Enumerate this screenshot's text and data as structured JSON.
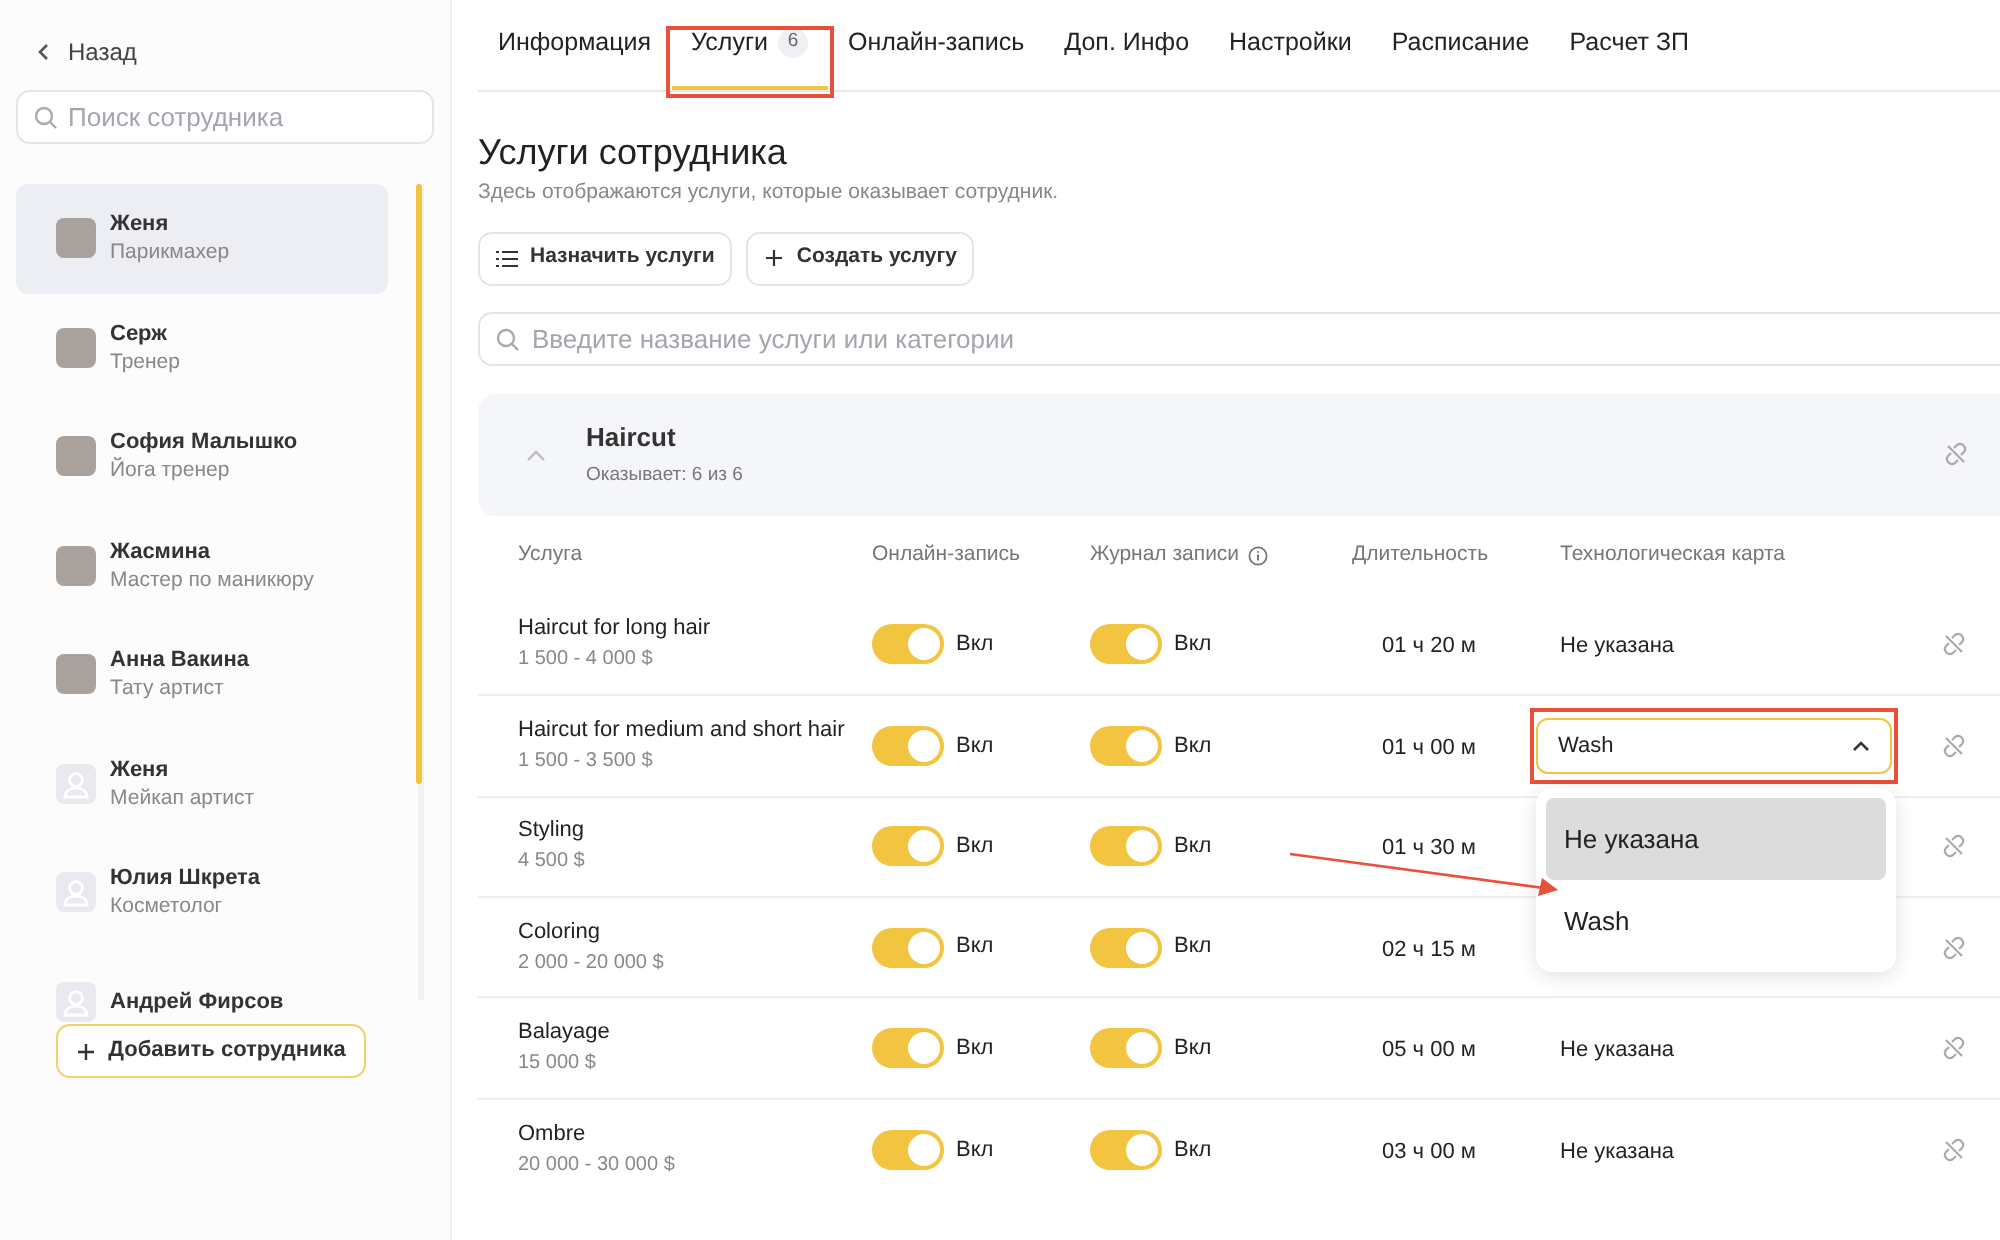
{
  "sidebar": {
    "back": "Назад",
    "search": {
      "placeholder": "Поиск сотрудника"
    },
    "employees": [
      {
        "name": "Женя",
        "role": "Парикмахер",
        "kind": "photo",
        "selected": true
      },
      {
        "name": "Серж",
        "role": "Тренер",
        "kind": "photo",
        "selected": false
      },
      {
        "name": "София Малышко",
        "role": "Йога тренер",
        "kind": "photo",
        "selected": false
      },
      {
        "name": "Жасмина",
        "role": "Мастер по маникюру",
        "kind": "photo",
        "selected": false
      },
      {
        "name": "Анна Вакина",
        "role": "Тату артист",
        "kind": "photo",
        "selected": false
      },
      {
        "name": "Женя",
        "role": "Мейкап артист",
        "kind": "placeholder",
        "selected": false
      },
      {
        "name": "Юлия Шкрета",
        "role": "Косметолог",
        "kind": "placeholder",
        "selected": false
      },
      {
        "name": "Андрей Фирсов",
        "kind": "placeholder",
        "selected": false
      }
    ],
    "add_button": "Добавить сотрудника"
  },
  "tabs": [
    {
      "label": "Информация",
      "selected": false,
      "highlighted": false
    },
    {
      "label": "Услуги",
      "count": "6",
      "selected": true,
      "highlighted": true
    },
    {
      "label": "Онлайн-запись",
      "selected": false,
      "highlighted": false
    },
    {
      "label": "Доп. Инфо",
      "selected": false,
      "highlighted": false
    },
    {
      "label": "Настройки",
      "selected": false,
      "highlighted": false
    },
    {
      "label": "Расписание",
      "selected": false,
      "highlighted": false
    },
    {
      "label": "Расчет ЗП",
      "selected": false,
      "highlighted": false
    }
  ],
  "title": "Услуги сотрудника",
  "subtitle": "Здесь отображаются услуги, которые оказывает сотрудник.",
  "buttons": [
    {
      "label": "Назначить услуги"
    },
    {
      "label": "Создать услугу"
    }
  ],
  "search": {
    "placeholder": "Введите название услуги или категории"
  },
  "category": {
    "name": "Haircut",
    "count": "Оказывает: 6 из 6",
    "expanded": true
  },
  "table": {
    "columns": [
      "Услуга",
      "Онлайн-запись",
      "Журнал записи",
      "Длительность",
      "Технологическая карта"
    ],
    "rows": [
      {
        "name": "Haircut for long hair",
        "price": "1 500 - 4 000 $",
        "online": {
          "on": true,
          "label": "Вкл"
        },
        "journal": {
          "on": true,
          "label": "Вкл"
        },
        "duration": "01 ч 20 м",
        "tech_card": {
          "kind": "text",
          "value": "Не указана"
        }
      },
      {
        "name": "Haircut for medium and short hair",
        "price": "1 500 - 3 500 $",
        "online": {
          "on": true,
          "label": "Вкл"
        },
        "journal": {
          "on": true,
          "label": "Вкл"
        },
        "duration": "01 ч 00 м",
        "tech_card": {
          "kind": "select",
          "value": "Wash",
          "expanded": true,
          "highlighted": true,
          "options": [
            {
              "label": "Не указана",
              "hovered": true
            },
            {
              "label": "Wash",
              "hovered": false
            }
          ]
        }
      },
      {
        "name": "Styling",
        "price": "4 500 $",
        "online": {
          "on": true,
          "label": "Вкл"
        },
        "journal": {
          "on": true,
          "label": "Вкл"
        },
        "duration": "01 ч 30 м",
        "tech_card": {
          "kind": "hidden"
        }
      },
      {
        "name": "Coloring",
        "price": "2 000 - 20 000 $",
        "online": {
          "on": true,
          "label": "Вкл"
        },
        "journal": {
          "on": true,
          "label": "Вкл"
        },
        "duration": "02 ч 15 м",
        "tech_card": {
          "kind": "hidden"
        }
      },
      {
        "name": "Balayage",
        "price": "15 000 $",
        "online": {
          "on": true,
          "label": "Вкл"
        },
        "journal": {
          "on": true,
          "label": "Вкл"
        },
        "duration": "05 ч 00 м",
        "tech_card": {
          "kind": "text",
          "value": "Не указана"
        }
      },
      {
        "name": "Ombre",
        "price": "20 000 - 30 000 $",
        "online": {
          "on": true,
          "label": "Вкл"
        },
        "journal": {
          "on": true,
          "label": "Вкл"
        },
        "duration": "03 ч 00 м",
        "tech_card": {
          "kind": "text",
          "value": "Не указана"
        }
      }
    ]
  },
  "pointer_arrow": true
}
